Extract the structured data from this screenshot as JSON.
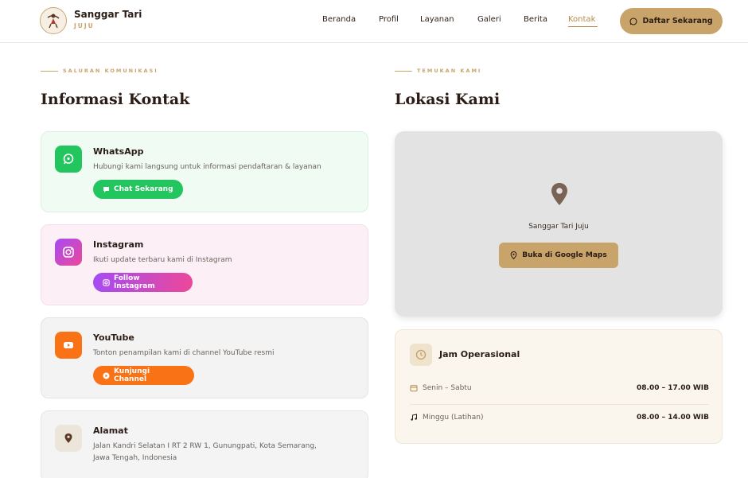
{
  "header": {
    "brand_name": "Sanggar Tari",
    "brand_sub": "JUJU",
    "nav": [
      "Beranda",
      "Profil",
      "Layanan",
      "Galeri",
      "Berita",
      "Kontak"
    ],
    "active_nav": "Kontak",
    "cta_label": "Daftar Sekarang"
  },
  "left": {
    "eyebrow": "SALURAN KOMUNIKASI",
    "heading": "Informasi Kontak",
    "cards": [
      {
        "title": "WhatsApp",
        "desc": "Hubungi kami langsung untuk informasi pendaftaran & layanan",
        "button": "Chat Sekarang",
        "icon": "whatsapp-icon",
        "color": "#22c55e",
        "bg": "#effbf3"
      },
      {
        "title": "Instagram",
        "desc": "Ikuti update terbaru kami di Instagram",
        "button": "Follow Instagram",
        "icon": "instagram-icon",
        "color": "#c13bd8",
        "bg": "#fcf0f6"
      },
      {
        "title": "YouTube",
        "desc": "Tonton penampilan kami di channel YouTube resmi",
        "button": "Kunjungi Channel",
        "icon": "youtube-icon",
        "color": "#f97316",
        "bg": "#f3f3f3"
      },
      {
        "title": "Alamat",
        "desc_line1": "Jalan Kandri Selatan I RT 2 RW 1, Gunungpati, Kota Semarang,",
        "desc_line2": "Jawa Tengah, Indonesia",
        "icon": "map-pin-icon",
        "bg": "#f4f4f4"
      }
    ]
  },
  "right": {
    "eyebrow": "TEMUKAN KAMI",
    "heading": "Lokasi Kami",
    "map_label": "Sanggar Tari Juju",
    "map_button": "Buka di Google Maps",
    "hours_title": "Jam Operasional",
    "hours": [
      {
        "label": "Senin – Sabtu",
        "value": "08.00 – 17.00 WIB",
        "icon": "calendar-icon"
      },
      {
        "label": "Minggu (Latihan)",
        "value": "08.00 – 14.00 WIB",
        "icon": "music-icon"
      }
    ]
  },
  "colors": {
    "accent": "#c9a46a",
    "dark": "#2b1d16",
    "active": "#b88a47"
  }
}
